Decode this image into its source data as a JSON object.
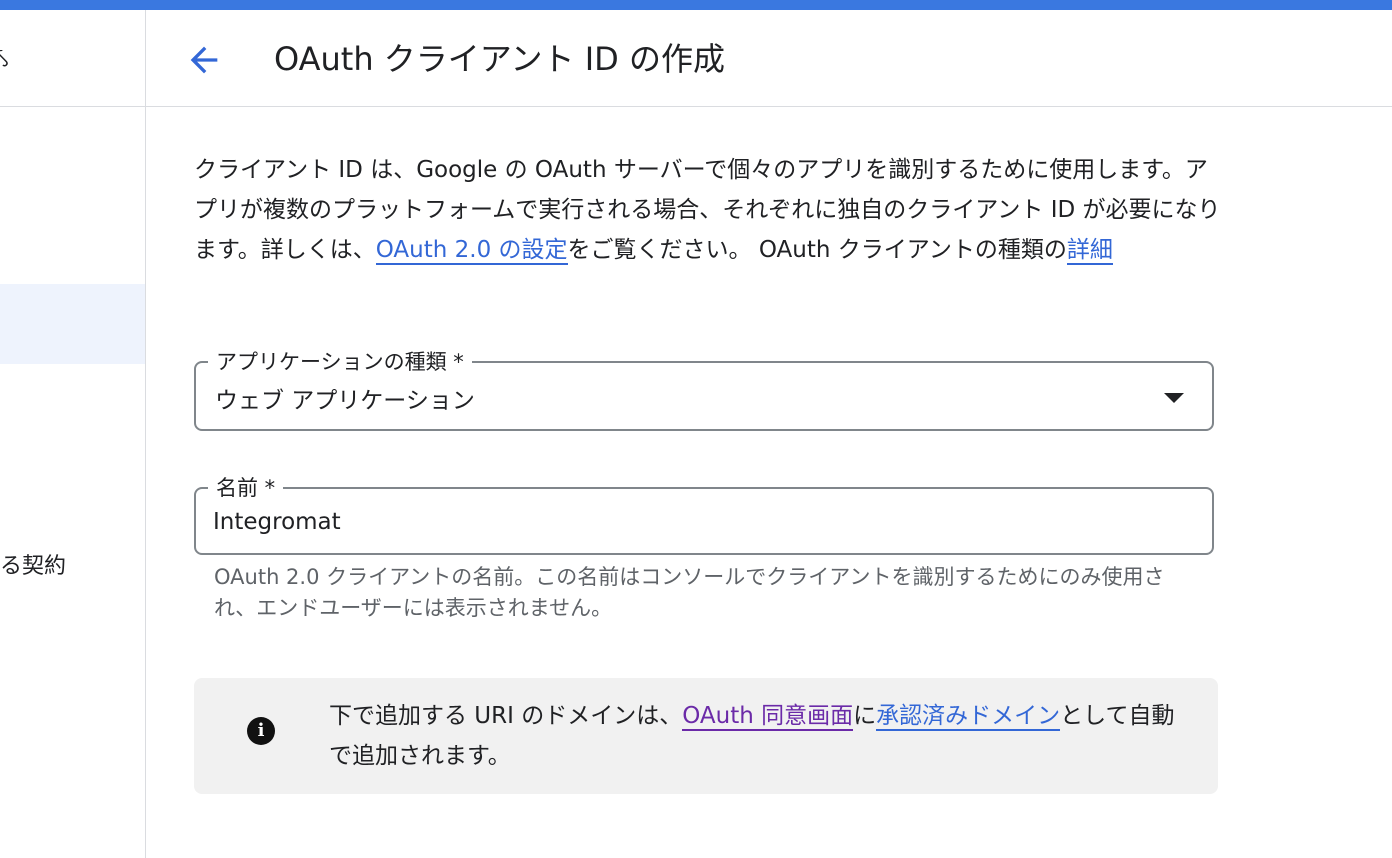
{
  "sidebar": {
    "item_label": "る契約"
  },
  "header": {
    "title": "OAuth クライアント ID の作成"
  },
  "description": {
    "text_before": "クライアント ID は、Google の OAuth サーバーで個々のアプリを識別するために使用します。アプリが複数のプラットフォームで実行される場合、それぞれに独自のクライアント ID が必要になります。詳しくは、",
    "link_setup": "OAuth 2.0 の設定",
    "text_middle": "をご覧ください。 OAuth クライアントの種類の",
    "link_details": "詳細"
  },
  "app_type": {
    "label": "アプリケーションの種類 *",
    "value": "ウェブ アプリケーション"
  },
  "name": {
    "label": "名前 *",
    "value": "Integromat",
    "hint": "OAuth 2.0 クライアントの名前。この名前はコンソールでクライアントを識別するためにのみ使用され、エンドユーザーには表示されません。"
  },
  "info": {
    "text_before": "下で追加する URI のドメインは、",
    "link_consent": "OAuth 同意画面",
    "text_middle": "に",
    "link_domains": "承認済みドメイン",
    "text_after": "として自動で追加されます。"
  },
  "colors": {
    "accent": "#3a78e0",
    "link": "#3367d6",
    "visited_link": "#6b2aa8"
  }
}
